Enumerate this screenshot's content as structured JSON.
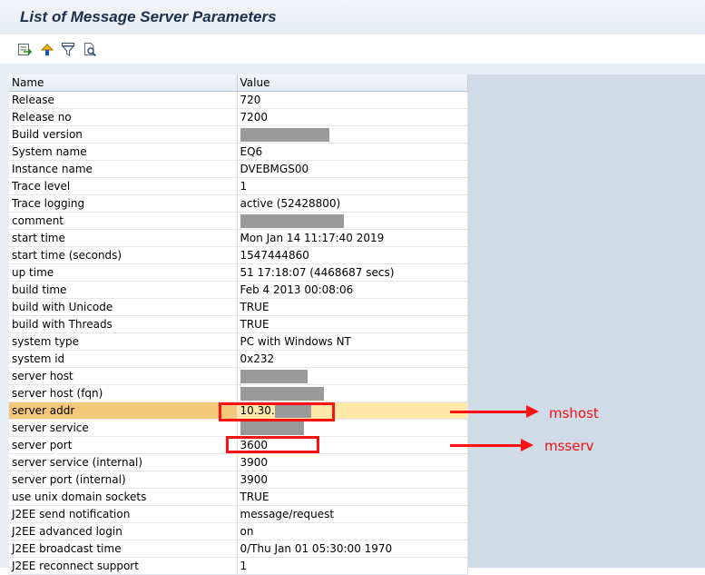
{
  "title": "List of Message Server Parameters",
  "toolbar": {
    "icons": [
      "export-icon",
      "sort-icon",
      "filter-icon",
      "find-icon"
    ]
  },
  "table": {
    "headers": [
      "Name",
      "Value"
    ],
    "rows": [
      {
        "name": "Release",
        "value": "720"
      },
      {
        "name": "Release no",
        "value": "7200"
      },
      {
        "name": "Build version",
        "value": ""
      },
      {
        "name": "System name",
        "value": "EQ6"
      },
      {
        "name": "Instance name",
        "value": "DVEBMGS00"
      },
      {
        "name": "Trace level",
        "value": "1"
      },
      {
        "name": "Trace logging",
        "value": "active (52428800)"
      },
      {
        "name": "comment",
        "value": ""
      },
      {
        "name": "start time",
        "value": "Mon Jan 14 11:17:40 2019"
      },
      {
        "name": "start time (seconds)",
        "value": "1547444860"
      },
      {
        "name": "up time",
        "value": "51 17:18:07 (4468687 secs)"
      },
      {
        "name": "build time",
        "value": "Feb  4 2013 00:08:06"
      },
      {
        "name": "build with Unicode",
        "value": "TRUE"
      },
      {
        "name": "build with Threads",
        "value": "TRUE"
      },
      {
        "name": "system type",
        "value": "PC with Windows NT"
      },
      {
        "name": "system id",
        "value": "0x232"
      },
      {
        "name": "server host",
        "value": ""
      },
      {
        "name": "server host (fqn)",
        "value": ""
      },
      {
        "name": "server addr",
        "value": "10.30."
      },
      {
        "name": "server service",
        "value": ""
      },
      {
        "name": "server port",
        "value": "3600"
      },
      {
        "name": "server service (internal)",
        "value": "3900"
      },
      {
        "name": "server port (internal)",
        "value": "3900"
      },
      {
        "name": "use unix domain sockets",
        "value": "TRUE"
      },
      {
        "name": "J2EE send notification",
        "value": "message/request"
      },
      {
        "name": "J2EE advanced login",
        "value": "on"
      },
      {
        "name": "J2EE broadcast time",
        "value": "0/Thu Jan 01 05:30:00 1970"
      },
      {
        "name": "J2EE reconnect support",
        "value": "1"
      }
    ]
  },
  "annotations": {
    "mshost": "mshost",
    "msserv": "msserv",
    "color": "#ff1111"
  }
}
